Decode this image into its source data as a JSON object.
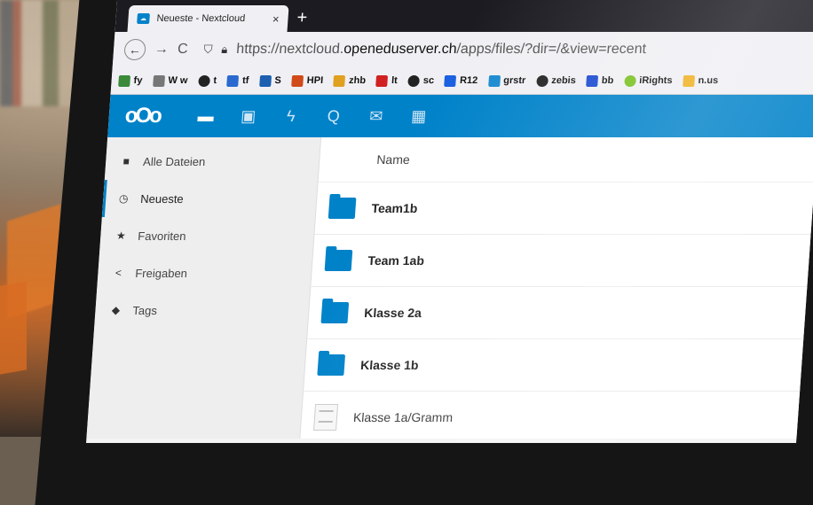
{
  "browser": {
    "tab": {
      "title": "Neueste - Nextcloud",
      "favicon": "nextcloud-favicon",
      "close": "×"
    },
    "new_tab": "+",
    "back": "←",
    "forward": "→",
    "reload": "C",
    "url_prefix": "https://nextcloud.",
    "url_domain": "openeduserver.ch",
    "url_path": "/apps/files/?dir=/&view=recent",
    "bookmarks": [
      {
        "label": "fy",
        "icon": "green-leaf-icon",
        "color": "#3a8a3a"
      },
      {
        "label": "W w",
        "icon": "wikipedia-icon",
        "color": "#777777"
      },
      {
        "label": "t",
        "icon": "globe-icon",
        "color": "#222222"
      },
      {
        "label": "tf",
        "icon": "square-icon",
        "color": "#2a6ad0"
      },
      {
        "label": "S",
        "icon": "square-icon",
        "color": "#1e5fb0"
      },
      {
        "label": "HPI",
        "icon": "square-icon",
        "color": "#d04a1a"
      },
      {
        "label": "zhb",
        "icon": "arc-icon",
        "color": "#e0a020"
      },
      {
        "label": "lt",
        "icon": "square-icon",
        "color": "#d02020"
      },
      {
        "label": "sc",
        "icon": "globe-icon",
        "color": "#222222"
      },
      {
        "label": "R12",
        "icon": "dropbox-icon",
        "color": "#1a60e0"
      },
      {
        "label": "grstr",
        "icon": "square-icon",
        "color": "#1a8ad0"
      },
      {
        "label": "zebis",
        "icon": "globe-icon",
        "color": "#222222"
      },
      {
        "label": "bb",
        "icon": "square-icon",
        "color": "#1a4ad0"
      },
      {
        "label": "iRights",
        "icon": "circle-icon",
        "color": "#7ac020"
      },
      {
        "label": "n.us",
        "icon": "square-icon",
        "color": "#f0b020"
      }
    ]
  },
  "header": {
    "logo": "oOo",
    "apps": [
      {
        "name": "files",
        "glyph": "▬"
      },
      {
        "name": "photos",
        "glyph": "▣"
      },
      {
        "name": "activity",
        "glyph": "ϟ"
      },
      {
        "name": "search",
        "glyph": "Q"
      },
      {
        "name": "mail",
        "glyph": "✉"
      },
      {
        "name": "calendar",
        "glyph": "▦"
      }
    ],
    "accent": "#0082c9"
  },
  "sidebar": {
    "items": [
      {
        "label": "Alle Dateien",
        "icon": "folder-icon",
        "glyph": "■"
      },
      {
        "label": "Neueste",
        "icon": "clock-icon",
        "glyph": "◷"
      },
      {
        "label": "Favoriten",
        "icon": "star-icon",
        "glyph": "★"
      },
      {
        "label": "Freigaben",
        "icon": "share-icon",
        "glyph": "<"
      },
      {
        "label": "Tags",
        "icon": "tag-icon",
        "glyph": "◆"
      }
    ]
  },
  "files": {
    "column_name": "Name",
    "rows": [
      {
        "name": "Team1b",
        "type": "folder"
      },
      {
        "name": "Team 1ab",
        "type": "folder"
      },
      {
        "name": "Klasse 2a",
        "type": "folder"
      },
      {
        "name": "Klasse 1b",
        "type": "folder"
      },
      {
        "name": "Klasse 1a/Gramm",
        "type": "document"
      }
    ]
  }
}
